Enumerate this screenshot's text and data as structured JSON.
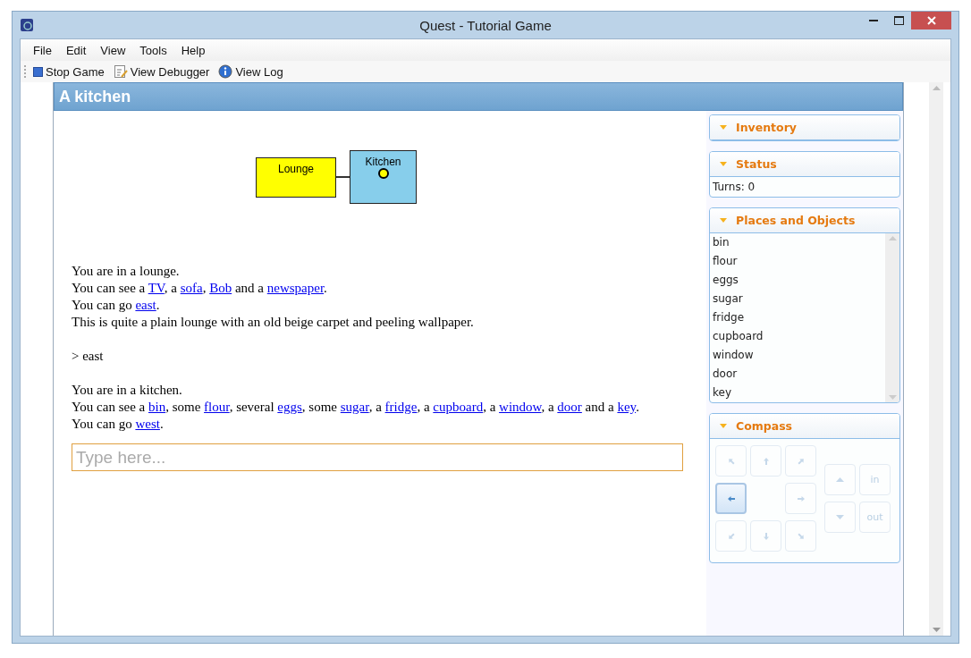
{
  "window": {
    "title": "Quest - Tutorial Game"
  },
  "menu": [
    "File",
    "Edit",
    "View",
    "Tools",
    "Help"
  ],
  "toolbar": [
    {
      "kind": "stop",
      "label": "Stop Game"
    },
    {
      "kind": "debugger",
      "label": "View Debugger"
    },
    {
      "kind": "info",
      "label": "View Log"
    }
  ],
  "location": "A kitchen",
  "map": {
    "rooms": [
      {
        "name": "Lounge",
        "color": "#ffff00",
        "current": false
      },
      {
        "name": "Kitchen",
        "color": "#87ceeb",
        "current": true
      }
    ]
  },
  "story": [
    {
      "lines": [
        [
          {
            "text": "You are in a lounge."
          }
        ],
        [
          {
            "text": "You can see a "
          },
          {
            "text": "TV",
            "link": true
          },
          {
            "text": ", a "
          },
          {
            "text": "sofa",
            "link": true
          },
          {
            "text": ", "
          },
          {
            "text": "Bob",
            "link": true
          },
          {
            "text": " and a "
          },
          {
            "text": "newspaper",
            "link": true
          },
          {
            "text": "."
          }
        ],
        [
          {
            "text": "You can go "
          },
          {
            "text": "east",
            "link": true
          },
          {
            "text": "."
          }
        ],
        [
          {
            "text": "This is quite a plain lounge with an old beige carpet and peeling wallpaper."
          }
        ]
      ]
    },
    {
      "lines": [
        [
          {
            "text": "> east"
          }
        ]
      ]
    },
    {
      "lines": [
        [
          {
            "text": "You are in a kitchen."
          }
        ],
        [
          {
            "text": "You can see a "
          },
          {
            "text": "bin",
            "link": true
          },
          {
            "text": ", some "
          },
          {
            "text": "flour",
            "link": true
          },
          {
            "text": ", several "
          },
          {
            "text": "eggs",
            "link": true
          },
          {
            "text": ", some "
          },
          {
            "text": "sugar",
            "link": true
          },
          {
            "text": ", a "
          },
          {
            "text": "fridge",
            "link": true
          },
          {
            "text": ", a "
          },
          {
            "text": "cupboard",
            "link": true
          },
          {
            "text": ", a "
          },
          {
            "text": "window",
            "link": true
          },
          {
            "text": ", a "
          },
          {
            "text": "door",
            "link": true
          },
          {
            "text": " and a "
          },
          {
            "text": "key",
            "link": true
          },
          {
            "text": "."
          }
        ],
        [
          {
            "text": "You can go "
          },
          {
            "text": "west",
            "link": true
          },
          {
            "text": "."
          }
        ]
      ]
    }
  ],
  "command": {
    "placeholder": "Type here..."
  },
  "panels": [
    {
      "kind": "empty",
      "title": "Inventory",
      "expanded": true
    },
    {
      "kind": "text",
      "title": "Status",
      "expanded": true,
      "lines": [
        "Turns: 0"
      ]
    },
    {
      "kind": "list",
      "title": "Places and Objects",
      "expanded": true,
      "items": [
        "bin",
        "flour",
        "eggs",
        "sugar",
        "fridge",
        "cupboard",
        "window",
        "door",
        "key"
      ]
    },
    {
      "kind": "compass",
      "title": "Compass",
      "expanded": true,
      "directions": [
        {
          "kind": "nw",
          "enabled": false
        },
        {
          "kind": "n",
          "enabled": false
        },
        {
          "kind": "ne",
          "enabled": false
        },
        {
          "kind": "w",
          "enabled": true
        },
        {
          "kind": "e",
          "enabled": false
        },
        {
          "kind": "sw",
          "enabled": false
        },
        {
          "kind": "s",
          "enabled": false
        },
        {
          "kind": "se",
          "enabled": false
        }
      ],
      "vertical": [
        {
          "kind": "up",
          "enabled": false
        },
        {
          "kind": "in",
          "label": "in",
          "enabled": false
        },
        {
          "kind": "down",
          "enabled": false
        },
        {
          "kind": "out",
          "label": "out",
          "enabled": false
        }
      ]
    }
  ]
}
